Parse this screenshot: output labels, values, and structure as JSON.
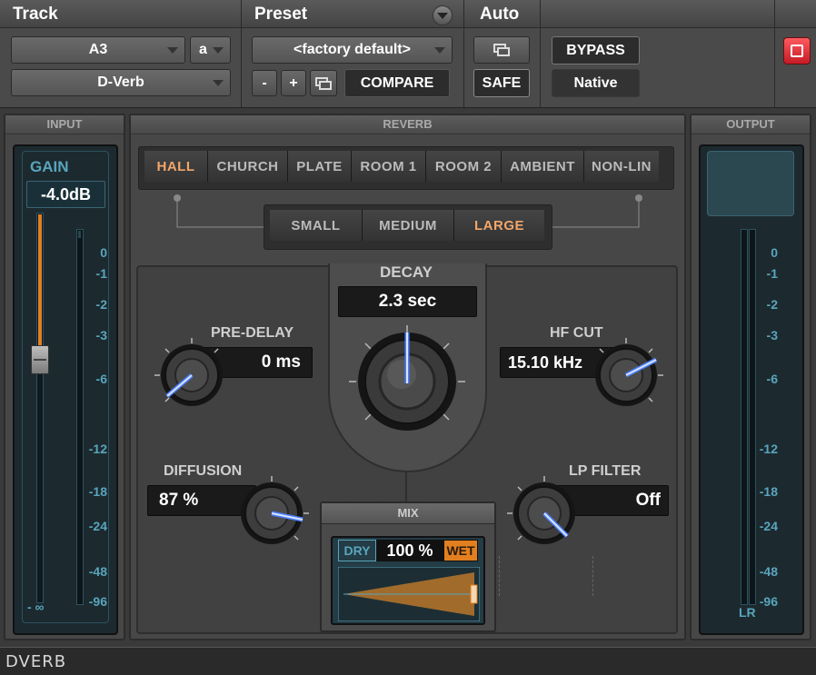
{
  "header": {
    "track_label": "Track",
    "preset_label": "Preset",
    "auto_label": "Auto",
    "track_name": "A3",
    "track_channel": "a",
    "plugin_name": "D-Verb",
    "preset_name": "<factory default>",
    "minus_label": "-",
    "plus_label": "+",
    "compare_label": "COMPARE",
    "safe_label": "SAFE",
    "bypass_label": "BYPASS",
    "native_label": "Native"
  },
  "input": {
    "title": "INPUT",
    "gain_label": "GAIN",
    "gain_value": "-4.0dB",
    "fader_bottom_label": "- ∞",
    "scale": [
      "0",
      "-1",
      "-2",
      "-3",
      "-6",
      "-12",
      "-18",
      "-24",
      "-48",
      "-96"
    ]
  },
  "output": {
    "title": "OUTPUT",
    "channels_label": "LR",
    "scale": [
      "0",
      "-1",
      "-2",
      "-3",
      "-6",
      "-12",
      "-18",
      "-24",
      "-48",
      "-96"
    ]
  },
  "reverb": {
    "title": "REVERB",
    "algorithms": [
      "HALL",
      "CHURCH",
      "PLATE",
      "ROOM 1",
      "ROOM 2",
      "AMBIENT",
      "NON-LIN"
    ],
    "selected_algorithm": "HALL",
    "sizes": [
      "SMALL",
      "MEDIUM",
      "LARGE"
    ],
    "selected_size": "LARGE",
    "decay_label": "DECAY",
    "decay_value": "2.3 sec",
    "predelay_label": "PRE-DELAY",
    "predelay_value": "0 ms",
    "hfcut_label": "HF CUT",
    "hfcut_value": "15.10 kHz",
    "diffusion_label": "DIFFUSION",
    "diffusion_value": "87 %",
    "lpfilter_label": "LP FILTER",
    "lpfilter_value": "Off"
  },
  "mix": {
    "title": "MIX",
    "dry_label": "DRY",
    "wet_label": "WET",
    "value": "100 %",
    "level": 1.0
  },
  "footer": {
    "plugin_label": "DVERB"
  },
  "colors": {
    "accent_orange": "#f2a66a",
    "meter_blue": "#59a5bd",
    "knob_indicator": "#4a7dff",
    "bypass_red": "#e0303a"
  }
}
